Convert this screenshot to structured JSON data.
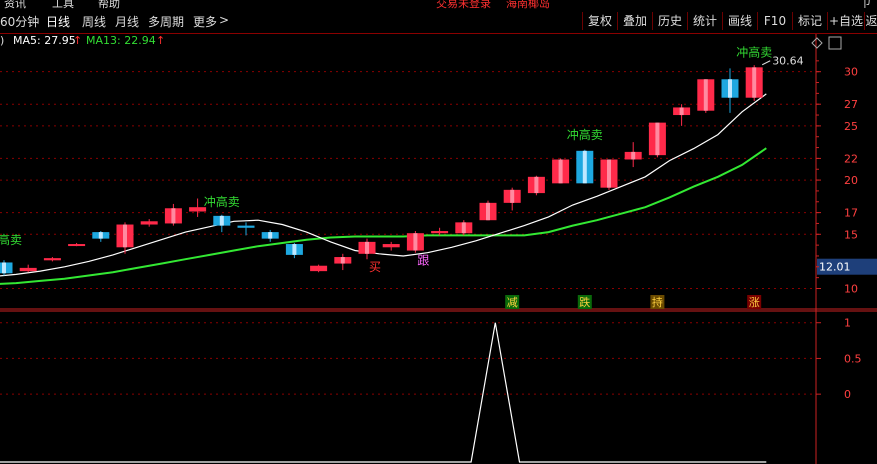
{
  "menu": {
    "items": [
      "资讯",
      "工具",
      "帮助"
    ],
    "notice": "交易未登录",
    "notice2": "海南椰岛",
    "close_glyph": "ㄗ"
  },
  "toolbar": {
    "periods": [
      "60分钟",
      "日线",
      "周线",
      "月线",
      "多周期",
      "更多"
    ],
    "active": "日线",
    "more_arrow": ">",
    "right_buttons": [
      "复权",
      "叠加",
      "历史",
      "统计",
      "画线",
      "F10",
      "标记",
      "+自选",
      "返"
    ]
  },
  "indicator": {
    "paren": ")",
    "ma5_label": "MA5: 27.95",
    "ma13_label": "MA13: 22.94",
    "arrow": "↑",
    "ma5_color": "#ffffff",
    "ma13_color": "#33dd33"
  },
  "colors": {
    "up": "#ff2a4a",
    "up_light": "#ff8aa0",
    "down": "#1ea8e0",
    "down_light": "#bfe8ff",
    "ma5": "#ffffff",
    "ma13": "#33e833",
    "grid": "#8a0000",
    "axis": "#cc2222",
    "signal_text": "#33dd33",
    "last_price_bg": "#1e3f7a"
  },
  "chart_data": {
    "type": "candlestick",
    "y_axis": {
      "ticks": [
        10,
        12.01,
        15,
        17,
        20,
        22,
        25,
        27,
        30
      ],
      "ylim": [
        8.2,
        32.0
      ]
    },
    "last_price": "12.01",
    "high_label": "30.64",
    "candles": [
      {
        "o": 12.4,
        "c": 11.4,
        "h": 12.6,
        "l": 11.2
      },
      {
        "o": 11.6,
        "c": 11.9,
        "h": 12.2,
        "l": 11.5
      },
      {
        "o": 12.6,
        "c": 12.8,
        "h": 12.9,
        "l": 12.5
      },
      {
        "o": 14.0,
        "c": 14.1,
        "h": 14.2,
        "l": 13.9
      },
      {
        "o": 15.2,
        "c": 14.6,
        "h": 15.3,
        "l": 14.3
      },
      {
        "o": 13.8,
        "c": 15.9,
        "h": 16.1,
        "l": 13.2
      },
      {
        "o": 15.9,
        "c": 16.2,
        "h": 16.4,
        "l": 15.7
      },
      {
        "o": 16.0,
        "c": 17.4,
        "h": 17.8,
        "l": 15.8
      },
      {
        "o": 17.1,
        "c": 17.5,
        "h": 18.3,
        "l": 16.6
      },
      {
        "o": 16.7,
        "c": 15.8,
        "h": 16.8,
        "l": 15.2
      },
      {
        "o": 15.8,
        "c": 15.6,
        "h": 16.1,
        "l": 14.9
      },
      {
        "o": 15.2,
        "c": 14.6,
        "h": 15.4,
        "l": 14.3
      },
      {
        "o": 14.1,
        "c": 13.1,
        "h": 14.2,
        "l": 12.8
      },
      {
        "o": 11.6,
        "c": 12.1,
        "h": 12.2,
        "l": 11.5
      },
      {
        "o": 12.3,
        "c": 12.9,
        "h": 13.2,
        "l": 11.7
      },
      {
        "o": 13.2,
        "c": 14.3,
        "h": 14.6,
        "l": 12.7
      },
      {
        "o": 13.8,
        "c": 14.1,
        "h": 14.3,
        "l": 13.5
      },
      {
        "o": 13.5,
        "c": 15.1,
        "h": 15.3,
        "l": 13.3
      },
      {
        "o": 15.1,
        "c": 15.3,
        "h": 15.6,
        "l": 14.9
      },
      {
        "o": 15.1,
        "c": 16.1,
        "h": 16.3,
        "l": 14.9
      },
      {
        "o": 16.3,
        "c": 17.9,
        "h": 18.1,
        "l": 16.3
      },
      {
        "o": 17.9,
        "c": 19.1,
        "h": 19.3,
        "l": 17.2
      },
      {
        "o": 18.8,
        "c": 20.3,
        "h": 20.4,
        "l": 18.6
      },
      {
        "o": 19.7,
        "c": 21.9,
        "h": 22.0,
        "l": 19.7
      },
      {
        "o": 22.7,
        "c": 19.7,
        "h": 22.8,
        "l": 19.7
      },
      {
        "o": 19.3,
        "c": 21.9,
        "h": 21.9,
        "l": 19.1
      },
      {
        "o": 21.9,
        "c": 22.6,
        "h": 23.5,
        "l": 21.2
      },
      {
        "o": 22.3,
        "c": 25.3,
        "h": 25.3,
        "l": 22.1
      },
      {
        "o": 26.0,
        "c": 26.7,
        "h": 27.0,
        "l": 25.0
      },
      {
        "o": 26.4,
        "c": 29.3,
        "h": 29.3,
        "l": 26.2
      },
      {
        "o": 29.3,
        "c": 27.6,
        "h": 30.3,
        "l": 26.2
      },
      {
        "o": 27.6,
        "c": 30.4,
        "h": 30.6,
        "l": 27.3
      }
    ],
    "ma5": [
      11.1,
      11.3,
      11.6,
      12.0,
      12.5,
      13.1,
      13.8,
      14.5,
      15.2,
      15.7,
      16.2,
      16.3,
      15.9,
      15.2,
      14.3,
      13.5,
      13.2,
      13.0,
      13.3,
      13.8,
      14.4,
      15.1,
      15.8,
      16.6,
      17.7,
      18.5,
      19.4,
      20.3,
      21.8,
      22.9,
      24.2,
      26.3,
      27.95
    ],
    "ma13": [
      10.4,
      10.5,
      10.7,
      10.9,
      11.2,
      11.5,
      11.9,
      12.3,
      12.7,
      13.1,
      13.5,
      13.9,
      14.2,
      14.5,
      14.7,
      14.8,
      14.8,
      14.8,
      14.9,
      14.9,
      14.9,
      14.9,
      14.9,
      15.2,
      15.8,
      16.3,
      16.9,
      17.5,
      18.4,
      19.4,
      20.3,
      21.4,
      22.94
    ],
    "signals_above": [
      {
        "i": 0,
        "text": "冲高卖",
        "y": 14.1
      },
      {
        "i": 9,
        "text": "冲高卖",
        "y": 17.6
      },
      {
        "i": 24,
        "text": "冲高卖",
        "y": 23.8
      },
      {
        "i": 31,
        "text": "冲高卖",
        "y": 31.4
      }
    ],
    "signals_below": [
      {
        "i": 15,
        "text": "买",
        "y": 11.6,
        "color": "#ff3030"
      },
      {
        "i": 17,
        "text": "跟",
        "y": 12.2,
        "color": "#ff66ff"
      }
    ],
    "bottom_labels": [
      {
        "i": 21,
        "text": "减",
        "bg": "#0a6a0a",
        "color": "#ffd040"
      },
      {
        "i": 24,
        "text": "跌",
        "bg": "#0a6a0a",
        "color": "#ffd040"
      },
      {
        "i": 27,
        "text": "持",
        "bg": "#6a4a00",
        "color": "#ffd040"
      },
      {
        "i": 31,
        "text": "涨",
        "bg": "#7a0000",
        "color": "#ffd040"
      }
    ],
    "sub": {
      "ticks": [
        1,
        0.5,
        0
      ],
      "ylim": [
        -0.95,
        1.15
      ],
      "x": [
        0,
        19.8,
        20.8,
        21.8,
        32
      ],
      "y": [
        -0.95,
        -0.95,
        1.0,
        -0.95,
        -0.95
      ]
    }
  }
}
